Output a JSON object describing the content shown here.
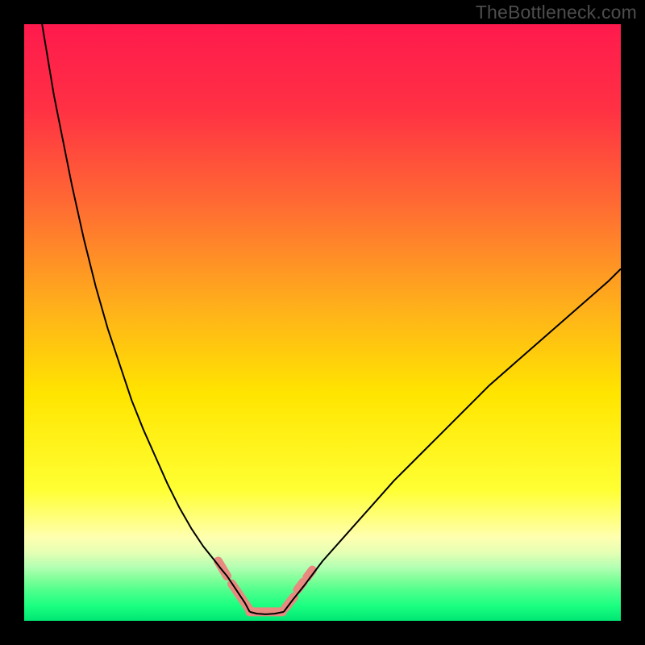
{
  "watermark": "TheBottleneck.com",
  "chart_data": {
    "type": "line",
    "title": "",
    "xlabel": "",
    "ylabel": "",
    "xlim": [
      0,
      100
    ],
    "ylim": [
      0,
      100
    ],
    "grid": false,
    "background_gradient": {
      "type": "vertical",
      "stops": [
        {
          "offset": 0.0,
          "color": "#ff1a4d"
        },
        {
          "offset": 0.14,
          "color": "#ff3044"
        },
        {
          "offset": 0.3,
          "color": "#ff6a33"
        },
        {
          "offset": 0.48,
          "color": "#ffb21a"
        },
        {
          "offset": 0.62,
          "color": "#ffe500"
        },
        {
          "offset": 0.78,
          "color": "#ffff33"
        },
        {
          "offset": 0.83,
          "color": "#ffff80"
        },
        {
          "offset": 0.86,
          "color": "#ffffb0"
        },
        {
          "offset": 0.885,
          "color": "#e6ffb3"
        },
        {
          "offset": 0.91,
          "color": "#b3ffb3"
        },
        {
          "offset": 0.93,
          "color": "#80ff99"
        },
        {
          "offset": 0.95,
          "color": "#4dff8c"
        },
        {
          "offset": 0.975,
          "color": "#1aff80"
        },
        {
          "offset": 1.0,
          "color": "#00e673"
        }
      ]
    },
    "series": [
      {
        "name": "curve-left-branch",
        "stroke": "#000000",
        "stroke_width": 2.0,
        "x": [
          3,
          4,
          5,
          6,
          8,
          10,
          12,
          14,
          16,
          18,
          20,
          22,
          24,
          26,
          28,
          30,
          32,
          33,
          34,
          35,
          36,
          37,
          37.8
        ],
        "y": [
          100,
          94,
          88,
          83,
          73,
          64,
          56,
          49,
          43,
          37,
          32,
          27.5,
          23,
          19,
          15.5,
          12.5,
          10,
          8.7,
          7.5,
          6,
          4.5,
          3,
          1.5
        ]
      },
      {
        "name": "curve-right-branch",
        "stroke": "#000000",
        "stroke_width": 2.0,
        "x": [
          43.5,
          45,
          47,
          50,
          54,
          58,
          62,
          66,
          70,
          74,
          78,
          82,
          86,
          90,
          94,
          98,
          100
        ],
        "y": [
          1.5,
          3.5,
          6,
          10,
          14.5,
          19,
          23.5,
          27.5,
          31.5,
          35.5,
          39.5,
          43,
          46.5,
          50,
          53.5,
          57,
          59
        ]
      },
      {
        "name": "curve-valley-flat",
        "stroke": "#000000",
        "stroke_width": 2.0,
        "x": [
          37.8,
          39,
          40.5,
          42,
          43.5
        ],
        "y": [
          1.5,
          1.2,
          1.1,
          1.2,
          1.5
        ]
      },
      {
        "name": "highlight-segments",
        "stroke": "#e88a80",
        "stroke_width": 11,
        "linecap": "round",
        "segments": [
          {
            "x": [
              32.5,
              34.0
            ],
            "y": [
              10,
              7.5
            ]
          },
          {
            "x": [
              34.8,
              37.8
            ],
            "y": [
              6.2,
              1.8
            ]
          },
          {
            "x": [
              37.8,
              43.3
            ],
            "y": [
              1.5,
              1.5
            ]
          },
          {
            "x": [
              43.8,
              45.2
            ],
            "y": [
              2.2,
              4.0
            ]
          },
          {
            "x": [
              45.8,
              46.8
            ],
            "y": [
              5.2,
              6.5
            ]
          },
          {
            "x": [
              47.4,
              48.3
            ],
            "y": [
              7.3,
              8.5
            ]
          }
        ]
      }
    ]
  }
}
